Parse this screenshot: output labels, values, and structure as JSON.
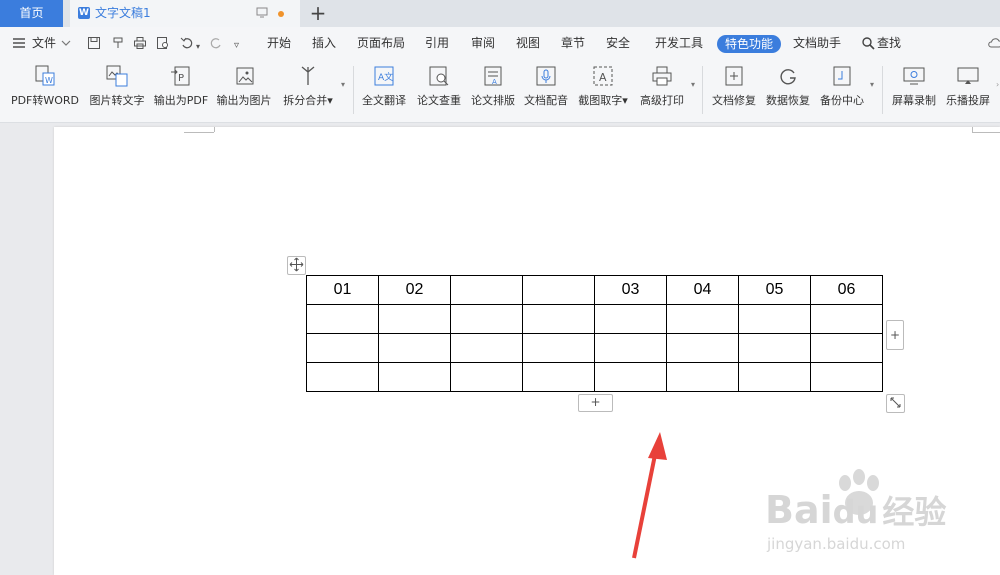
{
  "tabs": {
    "home": "首页",
    "doc_name": "文字文稿1",
    "doc_icon": "W",
    "add": "+"
  },
  "menu": {
    "file": "文件",
    "items": [
      "开始",
      "插入",
      "页面布局",
      "引用",
      "审阅",
      "视图",
      "章节",
      "安全",
      "开发工具",
      "特色功能",
      "文档助手"
    ],
    "active": "特色功能",
    "search": "查找",
    "accent": "#3b7ddd"
  },
  "ribbon": {
    "buttons": [
      "PDF转WORD",
      "图片转文字",
      "输出为PDF",
      "输出为图片",
      "拆分合并",
      "全文翻译",
      "论文查重",
      "论文排版",
      "文档配音",
      "截图取字",
      "高级打印",
      "文档修复",
      "数据恢复",
      "备份中心",
      "屏幕录制",
      "乐播投屏"
    ]
  },
  "table": {
    "rows": [
      [
        "01",
        "02",
        "",
        "",
        "03",
        "04",
        "05",
        "06"
      ],
      [
        "",
        "",
        "",
        "",
        "",
        "",
        "",
        ""
      ],
      [
        "",
        "",
        "",
        "",
        "",
        "",
        "",
        ""
      ],
      [
        "",
        "",
        "",
        "",
        "",
        "",
        "",
        ""
      ]
    ]
  },
  "handles": {
    "add_col": "+",
    "add_row": "+"
  },
  "watermark": {
    "brand": "Bai",
    "brand2": "du",
    "cn": "经验",
    "url": "jingyan.baidu.com"
  }
}
